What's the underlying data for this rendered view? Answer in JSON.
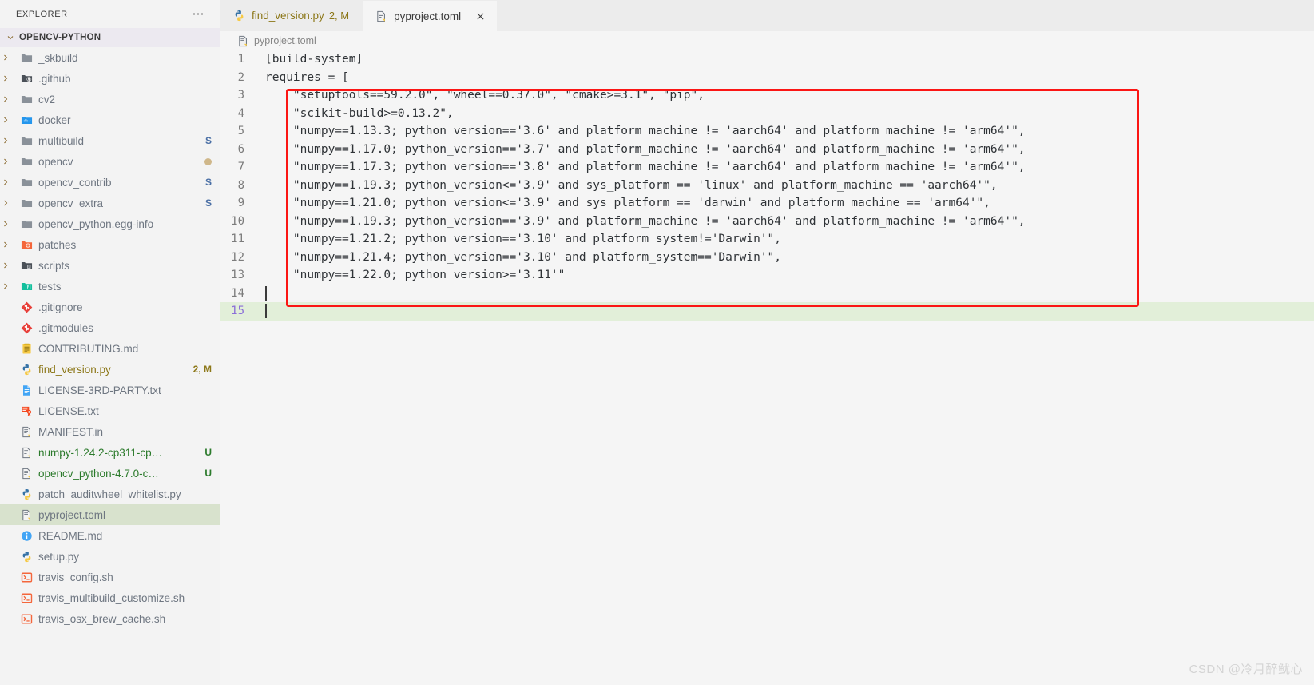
{
  "sidebar": {
    "header": {
      "title": "EXPLORER",
      "more_icon": "ellipsis-icon"
    },
    "root": {
      "label": "OPENCV-PYTHON",
      "expanded": true
    },
    "items": [
      {
        "label": "_skbuild",
        "type": "folder",
        "icon": "folder-icon",
        "icon_color": "#8a9199",
        "kind": "dir",
        "badge": "",
        "badge_color": ""
      },
      {
        "label": ".github",
        "type": "folder",
        "icon": "folder-github-icon",
        "icon_color": "#4a5057",
        "kind": "dir",
        "badge": "",
        "badge_color": ""
      },
      {
        "label": "cv2",
        "type": "folder",
        "icon": "folder-icon",
        "icon_color": "#8a9199",
        "kind": "dir",
        "badge": "",
        "badge_color": ""
      },
      {
        "label": "docker",
        "type": "folder",
        "icon": "folder-docker-icon",
        "icon_color": "#2496ed",
        "kind": "dir",
        "badge": "",
        "badge_color": ""
      },
      {
        "label": "multibuild",
        "type": "folder",
        "icon": "folder-icon",
        "icon_color": "#8a9199",
        "kind": "dir",
        "badge": "S",
        "badge_color": "#4a6fa5"
      },
      {
        "label": "opencv",
        "type": "folder",
        "icon": "folder-icon",
        "icon_color": "#8a9199",
        "kind": "dir",
        "badge": "dot",
        "badge_color": "#cfb78a"
      },
      {
        "label": "opencv_contrib",
        "type": "folder",
        "icon": "folder-icon",
        "icon_color": "#8a9199",
        "kind": "dir",
        "badge": "S",
        "badge_color": "#4a6fa5"
      },
      {
        "label": "opencv_extra",
        "type": "folder",
        "icon": "folder-icon",
        "icon_color": "#8a9199",
        "kind": "dir",
        "badge": "S",
        "badge_color": "#4a6fa5"
      },
      {
        "label": "opencv_python.egg-info",
        "type": "folder",
        "icon": "folder-icon",
        "icon_color": "#8a9199",
        "kind": "dir",
        "badge": "",
        "badge_color": ""
      },
      {
        "label": "patches",
        "type": "folder",
        "icon": "folder-patch-icon",
        "icon_color": "#f4663b",
        "kind": "dir",
        "badge": "",
        "badge_color": ""
      },
      {
        "label": "scripts",
        "type": "folder",
        "icon": "folder-script-icon",
        "icon_color": "#4a5057",
        "kind": "dir",
        "badge": "",
        "badge_color": ""
      },
      {
        "label": "tests",
        "type": "folder",
        "icon": "folder-test-icon",
        "icon_color": "#13bf9d",
        "kind": "dir",
        "badge": "",
        "badge_color": ""
      },
      {
        "label": ".gitignore",
        "type": "file",
        "icon": "git-icon",
        "icon_color": "#e8403a",
        "kind": "file",
        "badge": "",
        "badge_color": ""
      },
      {
        "label": ".gitmodules",
        "type": "file",
        "icon": "git-icon",
        "icon_color": "#e8403a",
        "kind": "file",
        "badge": "",
        "badge_color": ""
      },
      {
        "label": "CONTRIBUTING.md",
        "type": "file",
        "icon": "markdown-icon",
        "icon_color": "#f6c944",
        "kind": "file",
        "badge": "",
        "badge_color": ""
      },
      {
        "label": "find_version.py",
        "type": "file",
        "icon": "python-icon",
        "icon_color": "#3572a5",
        "kind": "file",
        "badge": "2, M",
        "badge_color": "#8c7718",
        "text_color": "#8c7718"
      },
      {
        "label": "LICENSE-3RD-PARTY.txt",
        "type": "file",
        "icon": "text-doc-icon",
        "icon_color": "#42a5f5",
        "kind": "file",
        "badge": "",
        "badge_color": ""
      },
      {
        "label": "LICENSE.txt",
        "type": "file",
        "icon": "certificate-icon",
        "icon_color": "#f4481f",
        "kind": "file",
        "badge": "",
        "badge_color": ""
      },
      {
        "label": "MANIFEST.in",
        "type": "file",
        "icon": "config-doc-icon",
        "icon_color": "#6e7681",
        "kind": "file",
        "badge": "",
        "badge_color": ""
      },
      {
        "label": "numpy-1.24.2-cp311-cp…",
        "type": "file",
        "icon": "config-doc-icon",
        "icon_color": "#6e7681",
        "kind": "file",
        "badge": "U",
        "badge_color": "#2b7a2b",
        "text_color": "#2b7a2b"
      },
      {
        "label": "opencv_python-4.7.0-c…",
        "type": "file",
        "icon": "config-doc-icon",
        "icon_color": "#6e7681",
        "kind": "file",
        "badge": "U",
        "badge_color": "#2b7a2b",
        "text_color": "#2b7a2b"
      },
      {
        "label": "patch_auditwheel_whitelist.py",
        "type": "file",
        "icon": "python-icon",
        "icon_color": "#3572a5",
        "kind": "file",
        "badge": "",
        "badge_color": ""
      },
      {
        "label": "pyproject.toml",
        "type": "file",
        "icon": "config-doc-icon",
        "icon_color": "#6e7681",
        "kind": "file",
        "badge": "",
        "badge_color": "",
        "selected": true
      },
      {
        "label": "README.md",
        "type": "file",
        "icon": "info-icon",
        "icon_color": "#42a5f5",
        "kind": "file",
        "badge": "",
        "badge_color": ""
      },
      {
        "label": "setup.py",
        "type": "file",
        "icon": "python-icon",
        "icon_color": "#3572a5",
        "kind": "file",
        "badge": "",
        "badge_color": ""
      },
      {
        "label": "travis_config.sh",
        "type": "file",
        "icon": "shell-icon",
        "icon_color": "#f4663b",
        "kind": "file",
        "badge": "",
        "badge_color": ""
      },
      {
        "label": "travis_multibuild_customize.sh",
        "type": "file",
        "icon": "shell-icon",
        "icon_color": "#f4663b",
        "kind": "file",
        "badge": "",
        "badge_color": ""
      },
      {
        "label": "travis_osx_brew_cache.sh",
        "type": "file",
        "icon": "shell-icon",
        "icon_color": "#f4663b",
        "kind": "file",
        "badge": "",
        "badge_color": ""
      }
    ]
  },
  "tabs": [
    {
      "label": "find_version.py",
      "badge": "2, M",
      "icon": "python-icon",
      "active": false,
      "closable": false
    },
    {
      "label": "pyproject.toml",
      "badge": "",
      "icon": "config-doc-icon",
      "active": true,
      "closable": true,
      "close_icon": "close-icon"
    }
  ],
  "breadcrumb": {
    "label": "pyproject.toml",
    "icon": "config-doc-icon"
  },
  "editor": {
    "lines": [
      {
        "n": "1",
        "text": "[build-system]"
      },
      {
        "n": "2",
        "text": "requires = ["
      },
      {
        "n": "3",
        "text": "    \"setuptools==59.2.0\", \"wheel==0.37.0\", \"cmake>=3.1\", \"pip\","
      },
      {
        "n": "4",
        "text": "    \"scikit-build>=0.13.2\","
      },
      {
        "n": "5",
        "text": "    \"numpy==1.13.3; python_version=='3.6' and platform_machine != 'aarch64' and platform_machine != 'arm64'\","
      },
      {
        "n": "6",
        "text": "    \"numpy==1.17.0; python_version=='3.7' and platform_machine != 'aarch64' and platform_machine != 'arm64'\","
      },
      {
        "n": "7",
        "text": "    \"numpy==1.17.3; python_version=='3.8' and platform_machine != 'aarch64' and platform_machine != 'arm64'\","
      },
      {
        "n": "8",
        "text": "    \"numpy==1.19.3; python_version<='3.9' and sys_platform == 'linux' and platform_machine == 'aarch64'\","
      },
      {
        "n": "9",
        "text": "    \"numpy==1.21.0; python_version<='3.9' and sys_platform == 'darwin' and platform_machine == 'arm64'\","
      },
      {
        "n": "10",
        "text": "    \"numpy==1.19.3; python_version=='3.9' and platform_machine != 'aarch64' and platform_machine != 'arm64'\","
      },
      {
        "n": "11",
        "text": "    \"numpy==1.21.2; python_version=='3.10' and platform_system!='Darwin'\","
      },
      {
        "n": "12",
        "text": "    \"numpy==1.21.4; python_version=='3.10' and platform_system=='Darwin'\","
      },
      {
        "n": "13",
        "text": "    \"numpy==1.22.0; python_version>='3.11'\""
      },
      {
        "n": "14",
        "text": ""
      },
      {
        "n": "15",
        "text": "",
        "current": true,
        "caret": true
      }
    ]
  },
  "annotation": {
    "shape": "rectangle",
    "color": "#fb1614"
  },
  "watermark": {
    "text": "CSDN @冷月醉鱿心"
  }
}
